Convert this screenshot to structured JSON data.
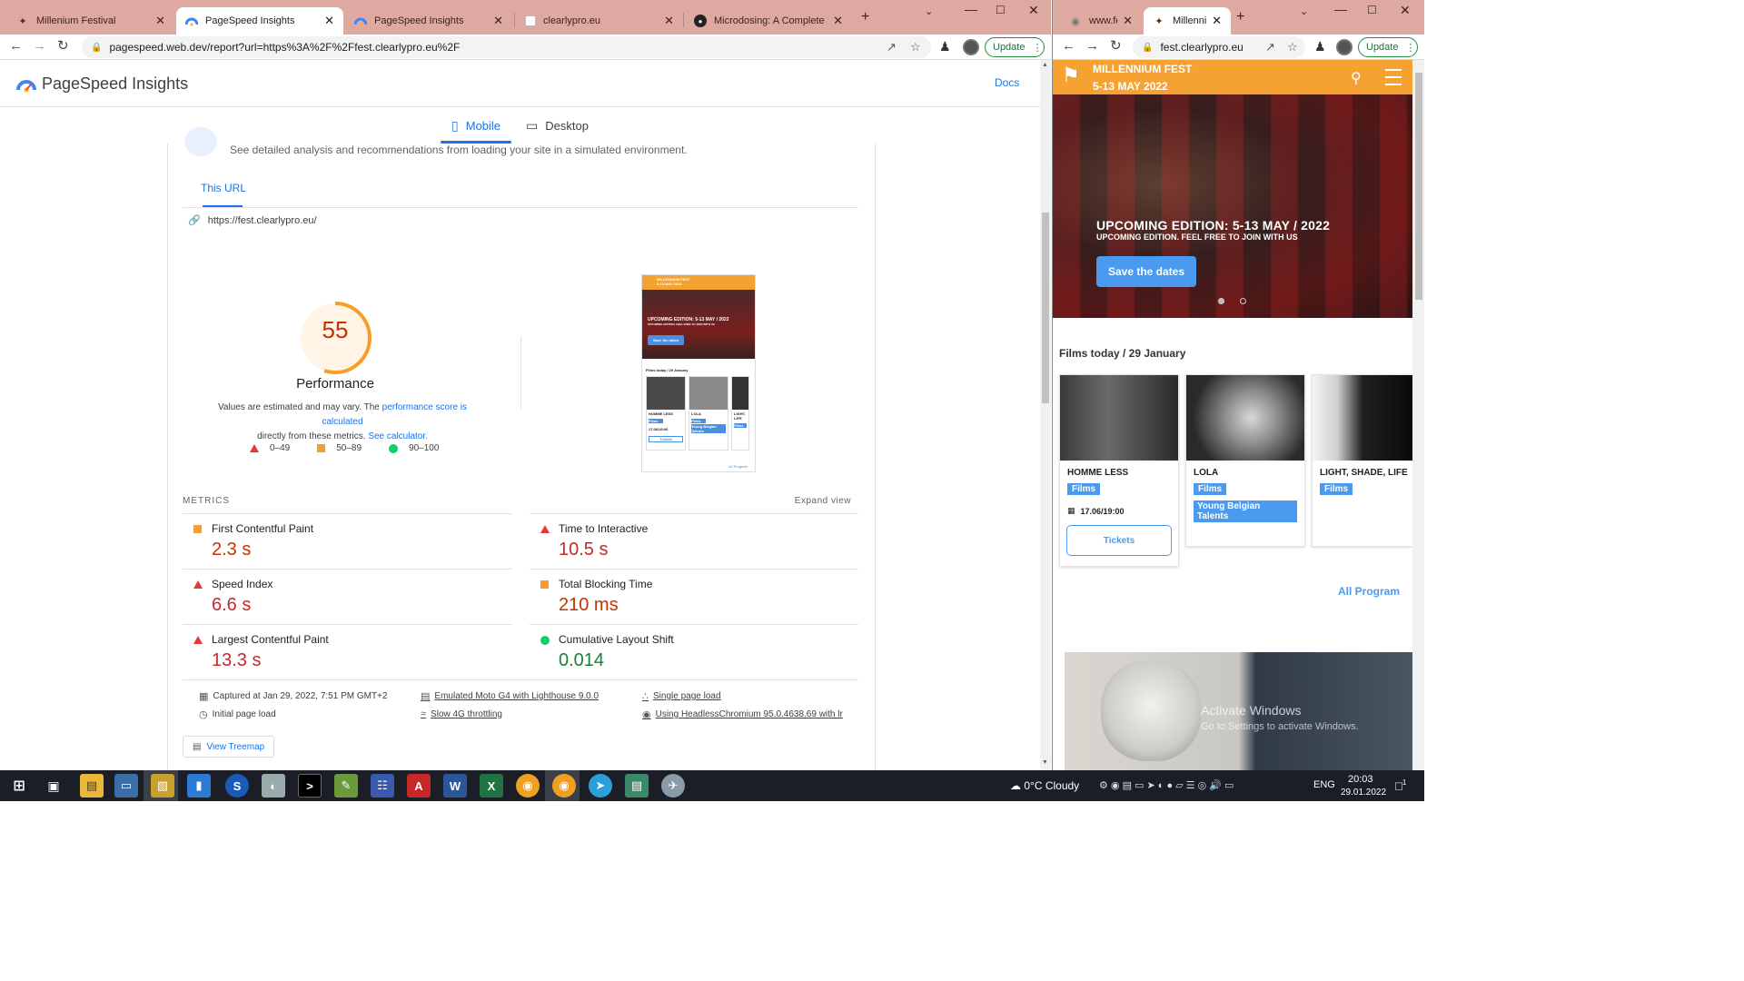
{
  "win1": {
    "tabs": [
      {
        "title": "Millenium Festival",
        "favicon": "festival-icon",
        "active": false
      },
      {
        "title": "PageSpeed Insights",
        "favicon": "psi-icon",
        "active": true
      },
      {
        "title": "PageSpeed Insights",
        "favicon": "psi-icon",
        "active": false
      },
      {
        "title": "clearlypro.eu",
        "favicon": "page-icon",
        "active": false
      },
      {
        "title": "Microdosing: A Complete Guid",
        "favicon": "globe-icon",
        "active": false
      }
    ],
    "url": "pagespeed.web.dev/report?url=https%3A%2F%2Ffest.clearlypro.eu%2F",
    "update_label": "Update"
  },
  "psi": {
    "brand": "PageSpeed Insights",
    "docs": "Docs",
    "tab_mobile": "Mobile",
    "tab_desktop": "Desktop",
    "sim_text": "See detailed analysis and recommendations from loading your site in a simulated environment.",
    "this_url_tab": "This URL",
    "tested_url": "https://fest.clearlypro.eu/",
    "score": "55",
    "score_value": 55,
    "score_label": "Performance",
    "desc_pre": "Values are estimated and may vary. The ",
    "desc_link1": "performance score is calculated",
    "desc_mid": " directly from these metrics. ",
    "desc_link2": "See calculator.",
    "legend": [
      "0–49",
      "50–89",
      "90–100"
    ],
    "metrics_title": "METRICS",
    "expand": "Expand view",
    "metrics": [
      {
        "label": "First Contentful Paint",
        "value": "2.3 s",
        "rating": "average"
      },
      {
        "label": "Time to Interactive",
        "value": "10.5 s",
        "rating": "fail"
      },
      {
        "label": "Speed Index",
        "value": "6.6 s",
        "rating": "fail"
      },
      {
        "label": "Total Blocking Time",
        "value": "210 ms",
        "rating": "average"
      },
      {
        "label": "Largest Contentful Paint",
        "value": "13.3 s",
        "rating": "fail"
      },
      {
        "label": "Cumulative Layout Shift",
        "value": "0.014",
        "rating": "pass"
      }
    ],
    "env": {
      "captured": "Captured at Jan 29, 2022, 7:51 PM GMT+2",
      "initial": "Initial page load",
      "device": "Emulated Moto G4 with Lighthouse 9.0.0",
      "throttling": "Slow 4G throttling",
      "single": "Single page load",
      "browser": "Using HeadlessChromium 95.0.4638.69 with lr"
    },
    "treemap": "View Treemap",
    "thumb": {
      "brand": "MILLENNIUM FEST",
      "dates": "5-13 MAY 2022",
      "hero": "UPCOMING EDITION: 5-13 MAY / 2022",
      "hero_sub": "UPCOMING EDITION. FEEL FREE TO JOIN WITH US",
      "btn": "Save the dates",
      "films": "Films today / 29 January",
      "card1": "HOMME LESS",
      "card2": "LOLA",
      "card3": "LIGHT, LIFE",
      "tag": "Films",
      "tag2": "Young Belgian Talents",
      "date": "17.06/19:00",
      "tickets": "Tickets",
      "all": "All Program"
    }
  },
  "win2": {
    "tabs": [
      {
        "title": "www.fes",
        "favicon": "globe-icon",
        "active": false
      },
      {
        "title": "Millenniu",
        "favicon": "festival-icon",
        "active": true
      }
    ],
    "url": "fest.clearlypro.eu",
    "update_label": "Update"
  },
  "fest": {
    "brand": "MILLENNIUM FEST",
    "dates": "5-13 MAY 2022",
    "hero_title": "UPCOMING EDITION: 5-13 MAY / 2022",
    "hero_sub": "UPCOMING EDITION. FEEL FREE TO JOIN WITH US",
    "save_btn": "Save the dates",
    "films_today": "Films today / 29 January",
    "cards": [
      {
        "name": "HOMME LESS",
        "tag": "Films",
        "date": "17.06/19:00",
        "tickets": "Tickets"
      },
      {
        "name": "LOLA",
        "tag": "Films",
        "tag2": "Young Belgian Talents"
      },
      {
        "name": "LIGHT, SHADE, LIFE",
        "tag": "Films"
      }
    ],
    "all_program": "All Program",
    "watermark1": "Activate Windows",
    "watermark2": "Go to Settings to activate Windows."
  },
  "taskbar": {
    "weather": "0°C  Cloudy",
    "lang": "ENG",
    "time": "20:03",
    "date": "29.01.2022",
    "notif": "1"
  }
}
